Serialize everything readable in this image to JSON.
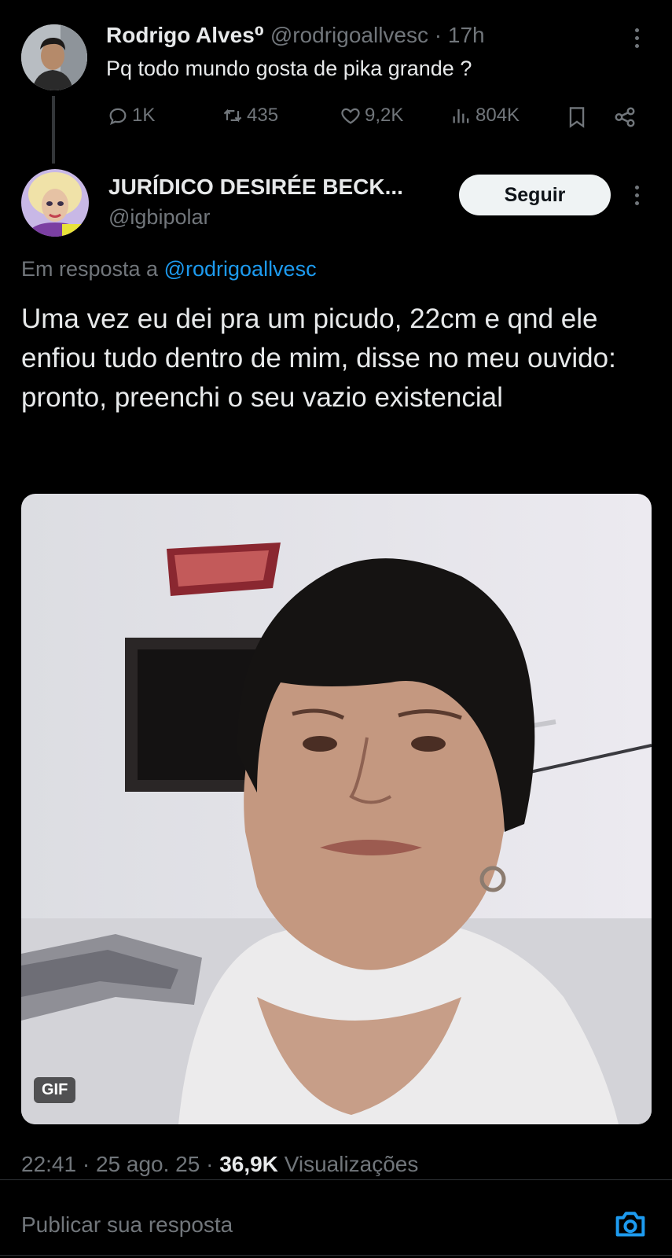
{
  "parent_tweet": {
    "author_name": "Rodrigo Alves⁰",
    "handle": "@rodrigoallvesc",
    "separator": "·",
    "time": "17h",
    "text": "Pq todo mundo gosta de pika grande ?",
    "actions": {
      "replies": "1K",
      "retweets": "435",
      "likes": "9,2K",
      "views": "804K"
    }
  },
  "reply_tweet": {
    "author_name": "JURÍDICO DESIRÉE BECK...",
    "handle": "@igbipolar",
    "follow_label": "Seguir",
    "reply_prefix": "Em resposta a",
    "reply_to": "@rodrigoallvesc",
    "text": "Uma vez eu dei pra um picudo, 22cm e qnd ele enfiou tudo dentro de mim, disse no meu ouvido: pronto, preenchi o seu vazio existencial",
    "media_badge": "GIF",
    "timestamp": "22:41 · 25 ago. 25 ·",
    "views_count": "36,9K",
    "views_label": "Visualizações"
  },
  "composer": {
    "placeholder": "Publicar sua resposta"
  },
  "colors": {
    "background": "#000000",
    "text": "#e7e9ea",
    "muted": "#71767b",
    "link": "#1d9bf0"
  }
}
